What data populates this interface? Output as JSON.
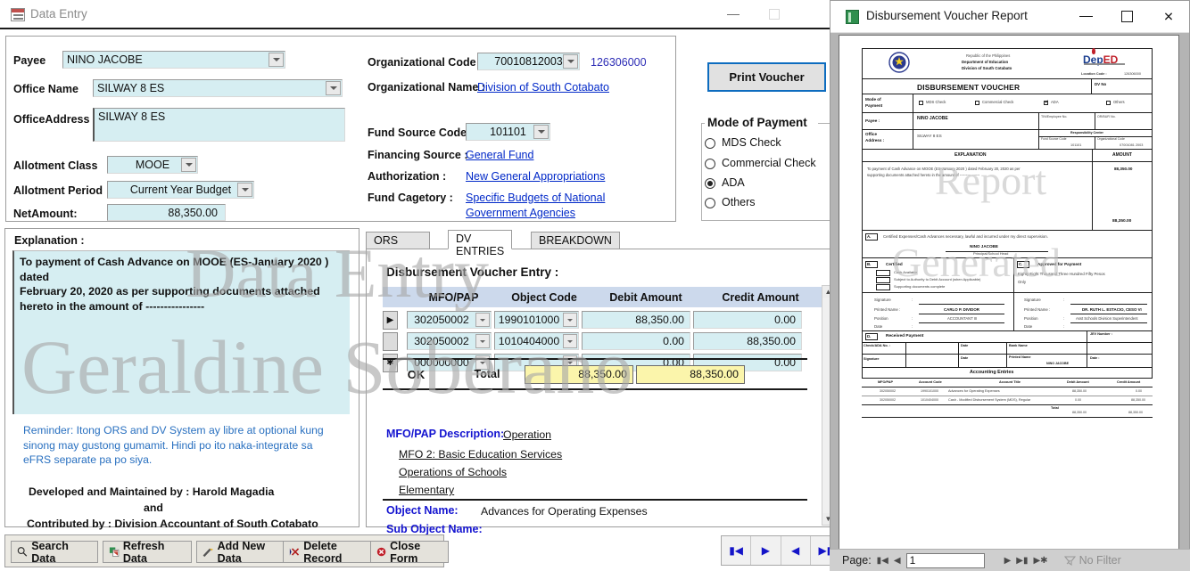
{
  "main_window": {
    "title": "Data Entry",
    "icon": "form-icon",
    "minimize": "minimize-icon",
    "maximize": "maximize-icon"
  },
  "form": {
    "fields": [
      {
        "label": "Payee",
        "value": "NINO JACOBE"
      },
      {
        "label": "Office Name",
        "value": "SILWAY 8 ES"
      },
      {
        "label": "OfficeAddress",
        "value": "SILWAY 8 ES"
      },
      {
        "label": "Allotment Class",
        "value": "MOOE"
      },
      {
        "label": "Allotment Period",
        "value": "Current Year Budget"
      },
      {
        "label": "NetAmount:",
        "value": "88,350.00"
      }
    ],
    "org_code_label": "Organizational Code",
    "org_code_value": "70010812003",
    "org_code_extra": "126306000",
    "org_name_label": "Organizational Name :",
    "org_name_value": "Division of South Cotabato",
    "fund_source_label": "Fund Source Code",
    "fund_source_value": "101101",
    "financing_label": "Financing Source :",
    "financing_value": "General Fund",
    "authorization_label": "Authorization :",
    "authorization_value": "New General Appropriations",
    "fund_category_label": "Fund Cagetory :",
    "fund_category_value_l1": "Specific Budgets of National",
    "fund_category_value_l2": "Government Agencies"
  },
  "print_button": "Print Voucher",
  "mode_of_payment": {
    "title": "Mode of Payment",
    "options": [
      {
        "label": "MDS Check",
        "selected": false
      },
      {
        "label": "Commercial Check",
        "selected": false
      },
      {
        "label": "ADA",
        "selected": true
      },
      {
        "label": "Others",
        "selected": false
      }
    ]
  },
  "explanation": {
    "title": "Explanation :",
    "text_l1": "To payment of Cash Advance on MOOE (ES-January 2020 ) dated",
    "text_l2": "February 20, 2020 as per supporting documents attached",
    "text_l3": "hereto in the amount of ----------------",
    "reminder": "Reminder: Itong ORS and DV System ay libre at optional kung sinong may gustong gumamit. Hindi po ito naka-integrate sa eFRS separate pa po siya.",
    "credit_line1": "Developed and Maintained by : Harold Magadia",
    "credit_line2": "and",
    "credit_line3": "Contributed by : Division Accountant of South Cotabato"
  },
  "tabs": [
    {
      "label": "ORS ENTRIES",
      "active": false
    },
    {
      "label": "DV ENTRIES",
      "active": true
    },
    {
      "label": "BREAKDOWN",
      "active": false
    }
  ],
  "dv_entry": {
    "heading": "Disbursement Voucher Entry :",
    "columns": [
      "MFO/PAP",
      "Object Code",
      "Debit Amount",
      "Credit Amount"
    ],
    "rows": [
      {
        "selector": "current",
        "mfo_pap": "302050002",
        "object_code": "1990101000",
        "debit": "88,350.00",
        "credit": "0.00"
      },
      {
        "selector": "",
        "mfo_pap": "302050002",
        "object_code": "1010404000",
        "debit": "0.00",
        "credit": "88,350.00"
      },
      {
        "selector": "new",
        "mfo_pap": "000000000",
        "object_code": "",
        "debit": "0.00",
        "credit": "0.00"
      }
    ],
    "ok_label": "OK",
    "total_label": "Total",
    "total_debit": "88,350.00",
    "total_credit": "88,350.00",
    "mfo_desc_label": "MFO/PAP Description:",
    "mfo_desc_value": "Operation",
    "mfo_line2": "MFO 2: Basic Education Services",
    "mfo_line3": "Operations of Schools",
    "mfo_line4": "Elementary",
    "object_name_label": "Object Name:",
    "object_name_value": "Advances for Operating Expenses",
    "sub_object_label": "Sub Object Name:",
    "sub_object_value": ""
  },
  "toolbar": [
    {
      "label": "Search Data",
      "icon": "magnifier-icon"
    },
    {
      "label": "Refresh Data",
      "icon": "refresh-icon"
    },
    {
      "label": "Add New Data",
      "icon": "pencil-icon"
    },
    {
      "label": "Delete Record",
      "icon": "delete-x-icon"
    },
    {
      "label": "Close Form",
      "icon": "close-circle-icon"
    }
  ],
  "record_nav": [
    "first-record-icon",
    "next-record-icon",
    "previous-record-icon",
    "last-record-icon"
  ],
  "report_window": {
    "title": "Disbursement Voucher Report",
    "icon": "report-icon",
    "minimize": "minimize-icon",
    "maximize": "maximize-icon",
    "close": "close-icon"
  },
  "report": {
    "header_line1": "Republic of the Philippines",
    "header_line2": "Department of Education",
    "header_line3": "Division of South Cotabato",
    "logo_text": "DepED",
    "location_code_label": "Location Code :",
    "location_code_value": "126306000",
    "doc_title": "DISBURSEMENT VOUCHER",
    "dv_no_label": "DV No",
    "mode_label_l1": "Mode of",
    "mode_label_l2": "Payment",
    "mode_options": [
      {
        "label": "MDS Check",
        "checked": false
      },
      {
        "label": "Commercial Check",
        "checked": false
      },
      {
        "label": "ADA",
        "checked": true
      },
      {
        "label": "Others",
        "checked": false
      }
    ],
    "payee_label": "Payee :",
    "payee_value": "NINO JACOBE",
    "tin_label": "TIN/Employee No.",
    "orbur_label": "OR/BUR No.",
    "office_addr_label_l1": "Office",
    "office_addr_label_l2": "Address :",
    "office_addr_value": "SILWAY 8 ES",
    "resp_center_label": "Responsibility Center",
    "fund_source_code_label": "Fund Source Code",
    "fund_source_code_value": "101101",
    "org_code_label": "Organizational Code",
    "org_code_value": "07001081 2003",
    "explanation_header": "EXPLANATION",
    "amount_header": "AMOUNT",
    "explanation_l1": "To payment of Cash Advance on MOOE (ES-January 2020 ) dated February 20, 2020 as per",
    "explanation_l2": "supporting documents attached hereto in the amount of ----------------",
    "amount_value": "88,350.00",
    "amount_total": "88,350.00",
    "section_a_letter": "A.",
    "section_a_text": "Certified Expenses/Cash Advances necessary, lawful and incurred under my direct supervision.",
    "section_a_name": "NINO JACOBE",
    "section_a_position": "Principal/School Head",
    "section_b_letter": "B.",
    "section_b_title": "Certified",
    "section_b_items": [
      "Cash Available",
      "Subject to Authority to Debit Account (when Applicable)",
      "Supporting documents complete"
    ],
    "section_c_letter": "C.",
    "section_c_title": "Approved for Payment",
    "section_c_amount_l1": "Eighty Eight Thousand Three Hundred Fifty Pesos",
    "section_c_amount_l2": "Only",
    "sig_labels": [
      "Signature",
      "Printed Name :",
      "Position",
      "Date"
    ],
    "left_printed_name": "CARLO P. DIVIDOR",
    "left_position": "ACCOUNTANT III",
    "right_printed_name": "DR. RUTH L. ESTACIO, CESO VI",
    "right_position": "Asst Schools Division Superintendent",
    "section_d_letter": "D.",
    "section_d_title": "Received Payment",
    "dv_number_label": "JEV Number :",
    "check_ada_label": "Check/ADA No. :",
    "date_label": "Date",
    "bank_name_label": "Bank Name",
    "signature_label": "Signature",
    "printed_name_label": "Printed Name",
    "received_printed_name": "NINO JACOBE",
    "date_label2": "Date :",
    "acct_entries_title": "Accounting Entries",
    "acct_columns": [
      "MFO/PAP",
      "Account Code",
      "Account Title",
      "Debit Amount",
      "Credit Amount"
    ],
    "acct_rows": [
      {
        "mfo_pap": "302050002",
        "account_code": "1990101000",
        "account_title": "Advances for Operating Expenses",
        "debit": "88,350.00",
        "credit": "0.00"
      },
      {
        "mfo_pap": "302050002",
        "account_code": "1010404000",
        "account_title": "Cash - Modified Disbursement System (MDS), Regular",
        "debit": "0.00",
        "credit": "88,350.00"
      }
    ],
    "acct_total_label": "Total",
    "acct_total_debit": "88,350.00",
    "acct_total_credit": "88,350.00"
  },
  "page_nav": {
    "label": "Page:",
    "value": "1",
    "filter_label": "No Filter"
  },
  "watermarks": {
    "w1": "Data Entry",
    "w2": "Geraldine Soberano",
    "w3": "Report",
    "w4": "Generated"
  },
  "colors": {
    "field_bg": "#d6eef2",
    "grid_header": "#ccd9ec",
    "total_highlight": "#fbf5ab",
    "link": "#0028c8",
    "reminder": "#2970c0",
    "accent_border": "#0d6cbf"
  }
}
